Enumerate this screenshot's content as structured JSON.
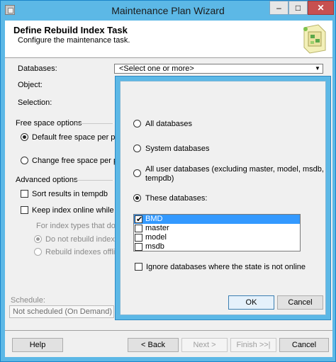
{
  "window": {
    "title": "Maintenance Plan Wizard",
    "minimize": "–",
    "maximize": "□",
    "close": "✕"
  },
  "header": {
    "title": "Define Rebuild Index Task",
    "subtitle": "Configure the maintenance task."
  },
  "form": {
    "databases_label": "Databases:",
    "databases_value": "<Select one or more>",
    "object_label": "Object:",
    "selection_label": "Selection:"
  },
  "free_space": {
    "group_label": "Free space options",
    "default_option": "Default free space per page",
    "change_option": "Change free space per pag"
  },
  "advanced": {
    "group_label": "Advanced options",
    "sort_tempdb": "Sort results in tempdb",
    "keep_online": "Keep index online while reind",
    "index_types_note": "For index types that do not",
    "do_not_rebuild": "Do not rebuild indexes",
    "rebuild_offline": "Rebuild indexes offline"
  },
  "schedule": {
    "label": "Schedule:",
    "value": "Not scheduled (On Demand)"
  },
  "footer": {
    "help": "Help",
    "back": "< Back",
    "next": "Next >",
    "finish": "Finish >>|",
    "cancel": "Cancel"
  },
  "popup": {
    "all_databases": "All databases",
    "system_databases": "System databases",
    "all_user_databases": "All user databases  (excluding master, model, msdb,",
    "all_user_databases_2": "tempdb)",
    "these_databases": "These databases:",
    "databases": [
      {
        "name": "BMD",
        "checked": true
      },
      {
        "name": "master",
        "checked": false
      },
      {
        "name": "model",
        "checked": false
      },
      {
        "name": "msdb",
        "checked": false
      }
    ],
    "ignore_offline": "Ignore databases where the state is not online",
    "ok": "OK",
    "cancel": "Cancel"
  },
  "icons": {
    "app": "wizard-app-icon",
    "graphic": "wizard-header-graphic",
    "dropdown": "chevron-down-icon"
  }
}
